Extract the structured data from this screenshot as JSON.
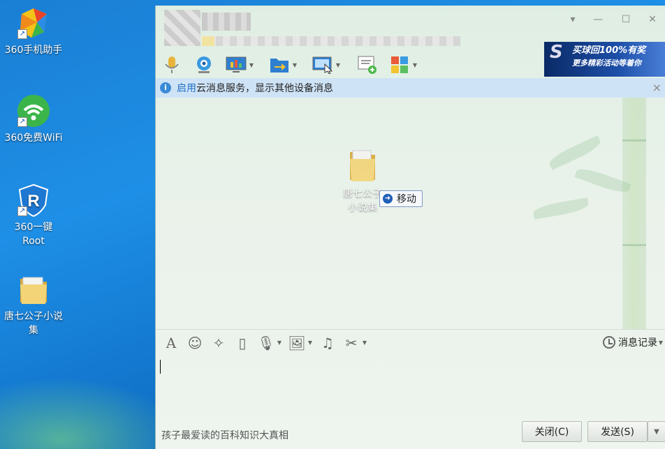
{
  "desktop": {
    "icons": [
      {
        "label": "360手机助手",
        "icon": "360-phone-assistant-icon"
      },
      {
        "label": "360免费WiFi",
        "icon": "360-wifi-icon"
      },
      {
        "label": "360一键Root",
        "icon": "360-root-icon"
      },
      {
        "label": "唐七公子小说集",
        "icon": "folder-icon"
      }
    ]
  },
  "chat": {
    "toolbar": {
      "items": [
        "voice-call-icon",
        "video-call-icon",
        "screen-share-icon",
        "file-transfer-icon",
        "remote-desktop-icon",
        "group-chat-icon",
        "apps-icon"
      ]
    },
    "ad": {
      "line1": "买球回100%有奖",
      "line2": "更多精彩活动等着你"
    },
    "notice": {
      "link": "启用",
      "text": "云消息服务，显示其他设备消息",
      "close": "×"
    },
    "drag": {
      "folder_label": "唐七公子小说集",
      "tooltip": "移动"
    },
    "edit_toolbar": {
      "items": [
        "font-icon",
        "emoji-icon",
        "magic-icon",
        "shake-icon",
        "mic-icon",
        "image-icon",
        "music-icon",
        "scissors-icon"
      ],
      "history": "消息记录"
    },
    "footer": {
      "tip": "孩子最爱读的百科知识大真相",
      "close_button": "关闭(C)",
      "send_button": "发送(S)"
    }
  }
}
